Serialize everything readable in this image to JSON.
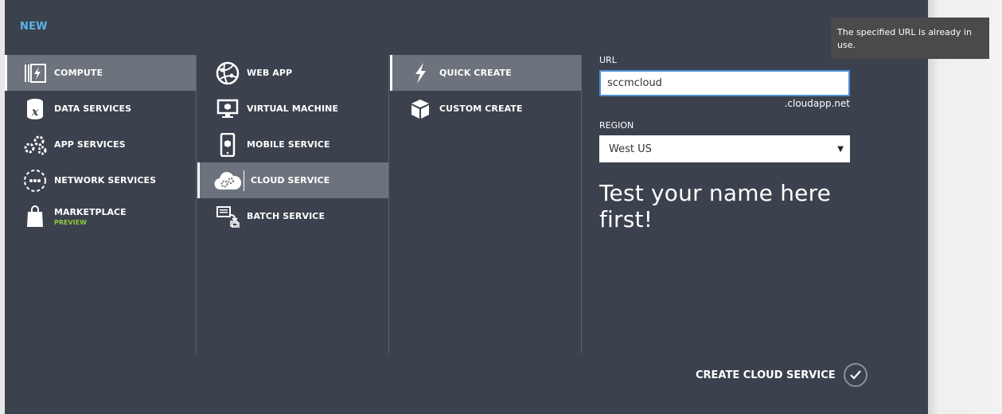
{
  "header": {
    "title": "NEW"
  },
  "categories": [
    {
      "label": "COMPUTE",
      "icon": "compute-icon",
      "selected": true
    },
    {
      "label": "DATA SERVICES",
      "icon": "data-services-icon"
    },
    {
      "label": "APP SERVICES",
      "icon": "app-services-icon"
    },
    {
      "label": "NETWORK SERVICES",
      "icon": "network-services-icon"
    },
    {
      "label": "MARKETPLACE",
      "sublabel": "PREVIEW",
      "icon": "marketplace-bag-icon"
    }
  ],
  "services": [
    {
      "label": "WEB APP",
      "icon": "web-app-icon"
    },
    {
      "label": "VIRTUAL MACHINE",
      "icon": "virtual-machine-icon"
    },
    {
      "label": "MOBILE SERVICE",
      "icon": "mobile-service-icon"
    },
    {
      "label": "CLOUD SERVICE",
      "icon": "cloud-service-icon",
      "selected": true
    },
    {
      "label": "BATCH SERVICE",
      "icon": "batch-service-icon"
    }
  ],
  "create_modes": [
    {
      "label": "QUICK CREATE",
      "icon": "lightning-icon",
      "selected": true
    },
    {
      "label": "CUSTOM CREATE",
      "icon": "box-icon"
    }
  ],
  "form": {
    "url_label": "URL",
    "url_value": "sccmcloud",
    "url_suffix": ".cloudapp.net",
    "region_label": "REGION",
    "region_value": "West US",
    "hint": "Test your name here first!"
  },
  "tooltip": {
    "text": "The specified URL is already in use."
  },
  "footer": {
    "create_label": "CREATE CLOUD SERVICE"
  },
  "colors": {
    "panel_bg": "#3b424d",
    "selected_bg": "#6d737c",
    "accent_blue": "#5ab4e6",
    "preview_green": "#8dc63f",
    "input_focus": "#4f8ed6",
    "tooltip_bg": "#4a4a4a"
  }
}
